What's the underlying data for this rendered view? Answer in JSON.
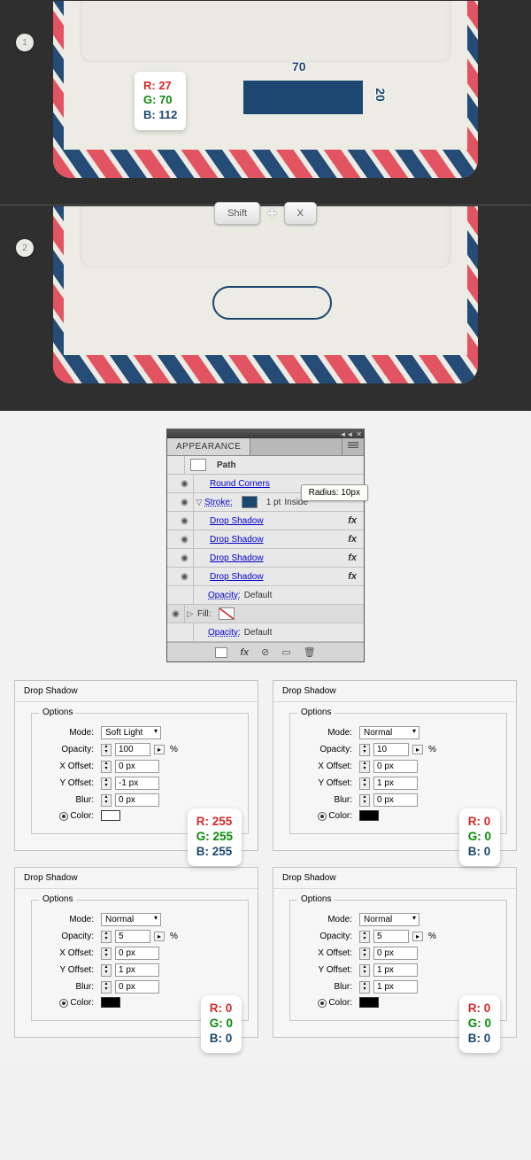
{
  "steps": {
    "s1": "1",
    "s2": "2"
  },
  "dims": {
    "w": "70",
    "h": "20"
  },
  "rgb_main": {
    "r": "R: 27",
    "g": "G: 70",
    "b": "B: 112"
  },
  "keys": {
    "shift": "Shift",
    "x": "X"
  },
  "panel": {
    "tab": "APPEARANCE",
    "path": "Path",
    "round_corners": "Round Corners",
    "radius_tip": "Radius: 10px",
    "stroke_label": "Stroke:",
    "stroke_weight": "1 pt",
    "stroke_align": "Inside",
    "drop_shadow": "Drop Shadow",
    "opacity_label": "Opacity:",
    "opacity_val": "Default",
    "fill_label": "Fill:",
    "fx": "fx"
  },
  "dialog_labels": {
    "title": "Drop Shadow",
    "legend": "Options",
    "mode": "Mode:",
    "opacity": "Opacity:",
    "xoffset": "X Offset:",
    "yoffset": "Y Offset:",
    "blur": "Blur:",
    "color": "Color:",
    "percent": "%"
  },
  "dialogs": [
    {
      "mode": "Soft Light",
      "opacity": "100",
      "xoff": "0 px",
      "yoff": "-1 px",
      "blur": "0 px",
      "swatch": "white",
      "rgb": {
        "r": "R: 255",
        "g": "G: 255",
        "b": "B: 255"
      }
    },
    {
      "mode": "Normal",
      "opacity": "10",
      "xoff": "0 px",
      "yoff": "1 px",
      "blur": "0 px",
      "swatch": "black",
      "rgb": {
        "r": "R: 0",
        "g": "G: 0",
        "b": "B: 0"
      }
    },
    {
      "mode": "Normal",
      "opacity": "5",
      "xoff": "0 px",
      "yoff": "1 px",
      "blur": "0 px",
      "swatch": "black",
      "rgb": {
        "r": "R: 0",
        "g": "G: 0",
        "b": "B: 0"
      }
    },
    {
      "mode": "Normal",
      "opacity": "5",
      "xoff": "0 px",
      "yoff": "1 px",
      "blur": "1 px",
      "swatch": "black",
      "rgb": {
        "r": "R: 0",
        "g": "G: 0",
        "b": "B: 0"
      }
    }
  ]
}
